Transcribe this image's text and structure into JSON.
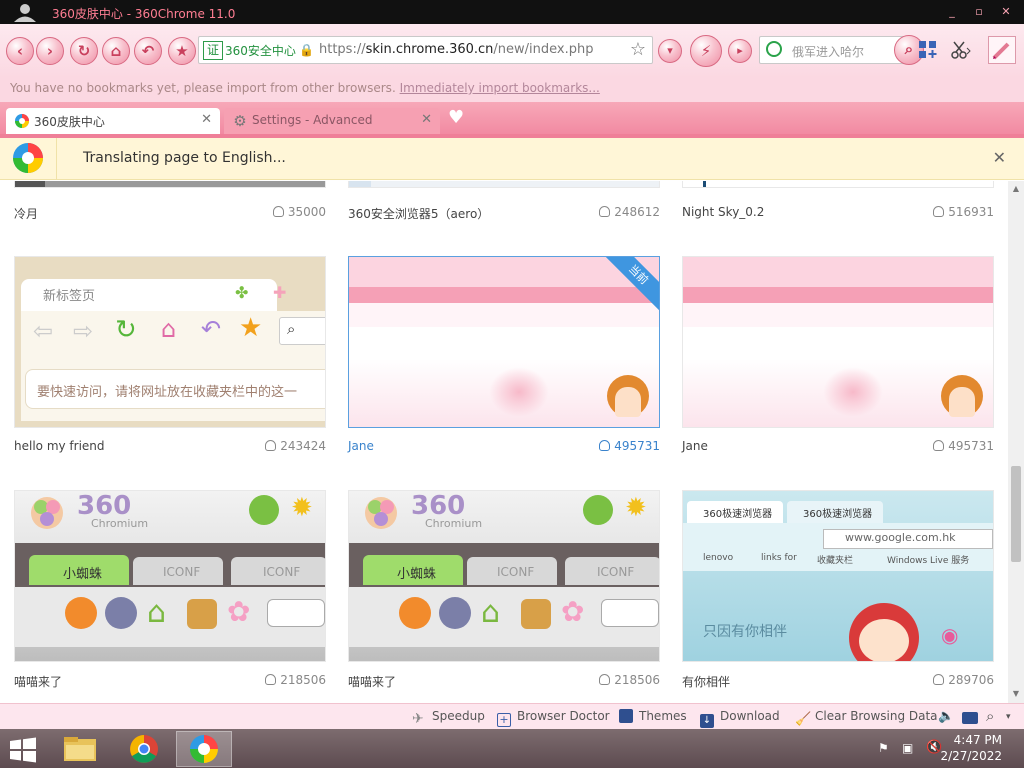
{
  "window": {
    "title": "360皮肤中心 - 360Chrome 11.0",
    "controls": [
      "_",
      "▫",
      "✕"
    ]
  },
  "toolbar": {
    "back_icon": "back-icon",
    "forward_icon": "forward-icon",
    "cert_label": "证",
    "cert_text": "360安全中心",
    "url_scheme": "https://",
    "url_host": "skin.chrome.360.cn",
    "url_path": "/new/index.php",
    "search_placeholder": "俄军进入哈尔"
  },
  "bookmarks": {
    "message": "You have no bookmarks yet, please import from other browsers.",
    "link": "Immediately import bookmarks..."
  },
  "tabs": [
    {
      "label": "360皮肤中心",
      "active": true
    },
    {
      "label": "Settings - Advanced",
      "active": false
    }
  ],
  "translate": {
    "message": "Translating page to English..."
  },
  "skins": {
    "row1": [
      {
        "name": "冷月",
        "count": "35000"
      },
      {
        "name": "360安全浏览器5（aero）",
        "count": "248612"
      },
      {
        "name": "Night Sky_0.2",
        "count": "516931"
      }
    ],
    "row2": [
      {
        "name": "hello my friend",
        "count": "243424",
        "thumb_title": "新标签页",
        "thumb_hint": "要快速访问，请将网址放在收藏夹栏中的这一"
      },
      {
        "name": "Jane",
        "count": "495731",
        "badge": "当前"
      },
      {
        "name": "Jane",
        "count": "495731"
      }
    ],
    "row3": [
      {
        "name": "喵喵来了",
        "count": "218506",
        "thumb_tab": "小蜘蛛",
        "thumb_tab2": "ICONF",
        "thumb_tab3": "ICONF",
        "logo_text": "360",
        "logo_sub": "Chromium"
      },
      {
        "name": "喵喵来了",
        "count": "218506",
        "thumb_tab": "小蜘蛛",
        "thumb_tab2": "ICONF",
        "thumb_tab3": "ICONF",
        "logo_text": "360",
        "logo_sub": "Chromium"
      },
      {
        "name": "有你相伴",
        "count": "289706",
        "thumb_tab": "360极速浏览器",
        "thumb_tab2": "360极速浏览器",
        "thumb_url": "www.google.com.hk",
        "thumb_bm1": "lenovo",
        "thumb_bm2": "links for",
        "thumb_bm3": "收藏夹栏",
        "thumb_bm4": "Windows Live 服务",
        "thumb_slogan": "只因有你相伴"
      }
    ]
  },
  "statusbar": {
    "speedup": "Speedup",
    "browser_doctor": "Browser Doctor",
    "themes": "Themes",
    "download": "Download",
    "clear_data": "Clear Browsing Data"
  },
  "taskbar": {
    "time": "4:47 PM",
    "date": "2/27/2022"
  },
  "colors": {
    "accent_pink": "#f28aa2",
    "link_blue": "#3a83cc",
    "translate_bar": "#fff6d7"
  }
}
